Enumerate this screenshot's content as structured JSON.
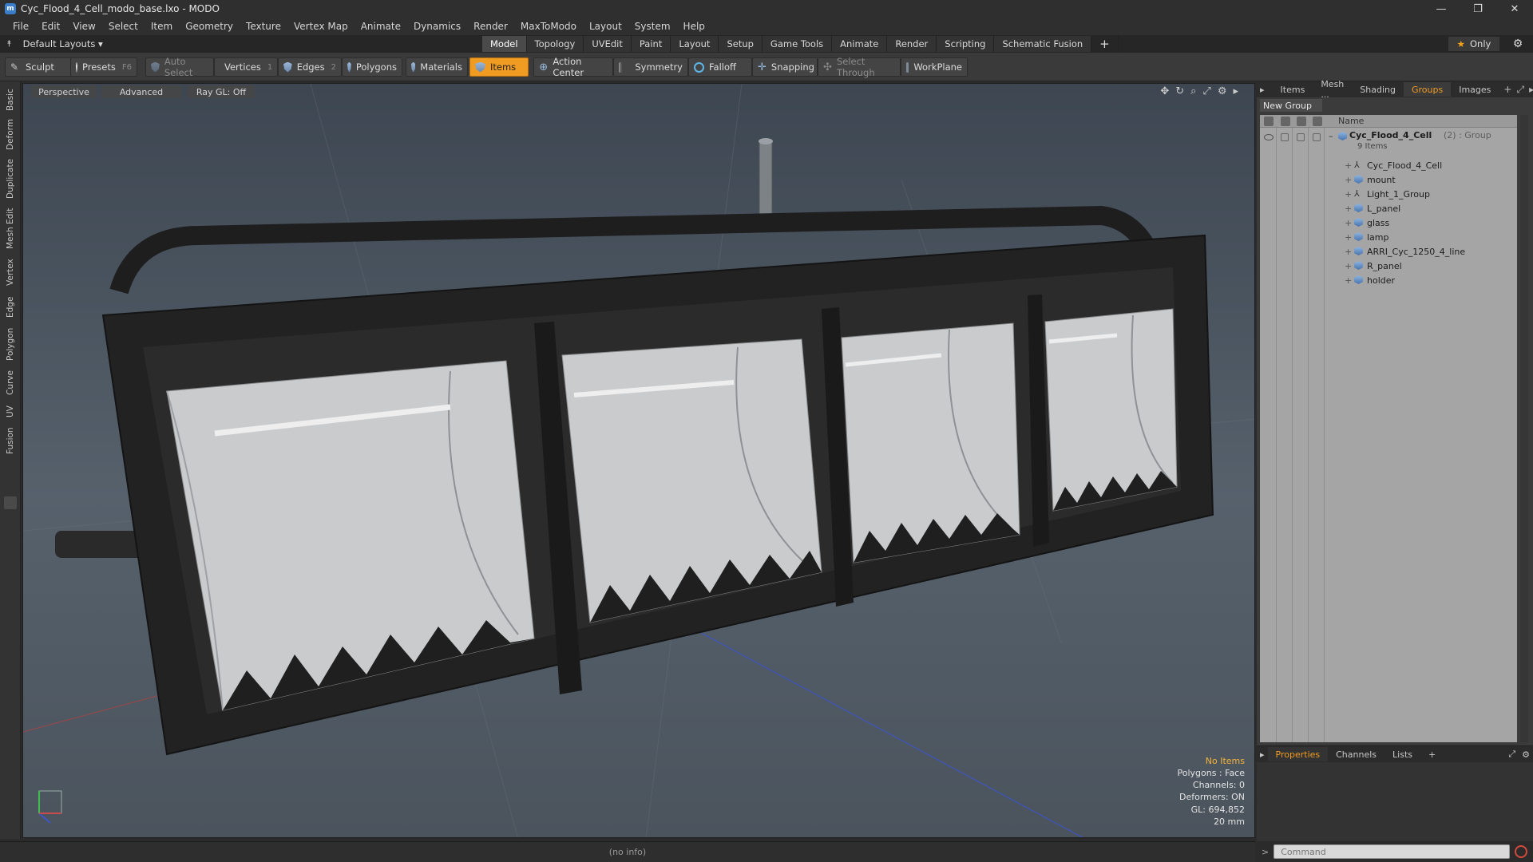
{
  "window": {
    "title": "Cyc_Flood_4_Cell_modo_base.lxo - MODO",
    "controls": [
      "—",
      "❐",
      "✕"
    ]
  },
  "menu": [
    "File",
    "Edit",
    "View",
    "Select",
    "Item",
    "Geometry",
    "Texture",
    "Vertex Map",
    "Animate",
    "Dynamics",
    "Render",
    "MaxToModo",
    "Layout",
    "System",
    "Help"
  ],
  "layout_bar": {
    "layout_name": "Default Layouts ▾",
    "tabs": [
      "Model",
      "Topology",
      "UVEdit",
      "Paint",
      "Layout",
      "Setup",
      "Game Tools",
      "Animate",
      "Render",
      "Scripting",
      "Schematic Fusion"
    ],
    "active_tab": "Model",
    "plus": "+",
    "only_label": "Only"
  },
  "toolbar": {
    "sculpt": "Sculpt",
    "presets": "Presets",
    "presets_key": "F6",
    "auto_select": "Auto Select",
    "vertices": "Vertices",
    "vertices_key": "1",
    "edges": "Edges",
    "edges_key": "2",
    "polygons": "Polygons",
    "materials": "Materials",
    "items": "Items",
    "action_center": "Action Center",
    "symmetry": "Symmetry",
    "falloff": "Falloff",
    "snapping": "Snapping",
    "select_through": "Select Through",
    "workplane": "WorkPlane"
  },
  "left_tabs": [
    "Basic",
    "Deform",
    "Duplicate",
    "Mesh Edit",
    "Vertex",
    "Edge",
    "Polygon",
    "Curve",
    "UV",
    "Fusion"
  ],
  "viewport": {
    "view_mode": "Perspective",
    "shading": "Advanced",
    "raygl": "Ray GL: Off",
    "info": {
      "selection": "No Items",
      "polygons": "Polygons : Face",
      "channels": "Channels: 0",
      "deformers": "Deformers: ON",
      "gl": "GL: 694,852",
      "scale": "20 mm"
    }
  },
  "status_bar": "(no info)",
  "right_panel": {
    "tabs": [
      "Items",
      "Mesh ...",
      "Shading",
      "Groups",
      "Images"
    ],
    "active_tab": "Groups",
    "new_group": "New Group",
    "name_header": "Name",
    "group": {
      "name": "Cyc_Flood_4_Cell",
      "suffix": "(2) : Group",
      "count": "9 Items"
    },
    "items": [
      {
        "label": "Cyc_Flood_4_Cell",
        "icon": "locator-icon"
      },
      {
        "label": "mount",
        "icon": "mesh-icon"
      },
      {
        "label": "Light_1_Group",
        "icon": "locator-icon"
      },
      {
        "label": "L_panel",
        "icon": "mesh-icon"
      },
      {
        "label": "glass",
        "icon": "mesh-icon"
      },
      {
        "label": "lamp",
        "icon": "mesh-icon"
      },
      {
        "label": "ARRI_Cyc_1250_4_line",
        "icon": "mesh-icon"
      },
      {
        "label": "R_panel",
        "icon": "mesh-icon"
      },
      {
        "label": "holder",
        "icon": "mesh-icon"
      }
    ]
  },
  "properties_panel": {
    "tabs": [
      "Properties",
      "Channels",
      "Lists"
    ],
    "active_tab": "Properties",
    "plus": "+"
  },
  "command": {
    "placeholder": "Command"
  },
  "colors": {
    "accent": "#f09b22",
    "panel_bg": "#3b3b3b",
    "tree_bg": "#a5a5a5"
  }
}
